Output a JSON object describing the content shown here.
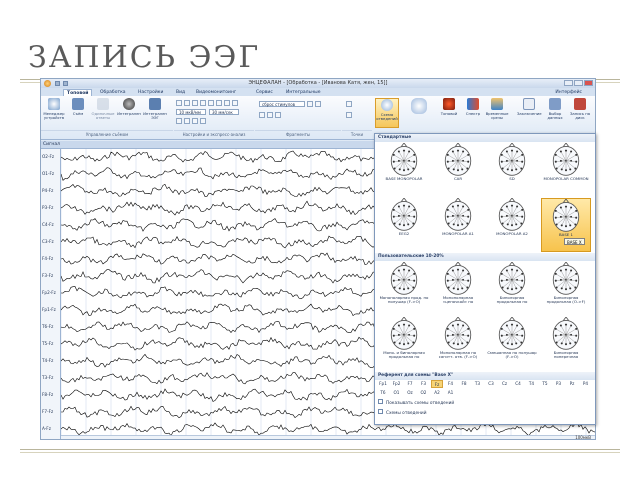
{
  "slide": {
    "title": "ЗАПИСЬ ЭЭГ"
  },
  "window": {
    "title": "ЭНЦЕФАЛАН - [Обработка - [Иванова Катя, жен, 15]]",
    "help_menu": "Интерфейс"
  },
  "tabs": [
    "Топовой",
    "Обработка",
    "Настройки",
    "Вид",
    "Видеомонитоинг",
    "Сервис",
    "Интегральные"
  ],
  "ribbon": {
    "buttons": [
      {
        "label": "Менеджер устройств",
        "icon": "devices-icon"
      },
      {
        "label": "Съём",
        "icon": "record-icon"
      },
      {
        "label": "Одиночные ответы",
        "icon": "single-responses-icon"
      },
      {
        "label": "Интегрален",
        "icon": "headphones-icon"
      },
      {
        "label": "Интегрален ЭЭГ",
        "icon": "integral-eeg-icon"
      }
    ],
    "group_labels": [
      "Управление съёмом",
      "Настройки и экспресс-анализ",
      "Фрагменты",
      "Точки"
    ],
    "sensitivity": "10 мкВ/мм",
    "speed": "30 мм/сек",
    "stimulus": "сброс стимулов",
    "right_buttons": [
      {
        "label": "Схема отведений",
        "icon": "montage-scheme-icon"
      },
      {
        "label": "Топовой",
        "icon": "topo-icon"
      },
      {
        "label": "Спектр",
        "icon": "spectrum-icon"
      },
      {
        "label": "Временные срезы",
        "icon": "time-slices-icon"
      },
      {
        "label": "Заключение",
        "icon": "conclusion-icon"
      },
      {
        "label": "Выбор данных",
        "icon": "data-select-icon"
      },
      {
        "label": "Запись на диск",
        "icon": "save-disk-icon"
      }
    ]
  },
  "signal_header": "Сигнал",
  "channels": [
    "O2-Fz",
    "O1-Fz",
    "P4-Fz",
    "P3-Fz",
    "C4-Fz",
    "C3-Fz",
    "F4-Fz",
    "F3-Fz",
    "Fp2-Fz",
    "Fp1-Fz",
    "T6-Fz",
    "T5-Fz",
    "T4-Fz",
    "T3-Fz",
    "F8-Fz",
    "F7-Fz",
    "A-Fz"
  ],
  "scale_label": "100мкВ",
  "montage_popup": {
    "standard_header": "Стандартные",
    "standard": [
      "BASE MONOPOLAR",
      "CAR",
      "SD",
      "MONOPOLAR COMMON",
      "EEG2",
      "MONOPOLAR A1",
      "MONOPOLAR A2",
      "BASE 1"
    ],
    "user_header": "Пользовательские 10-20%",
    "user": [
      "Монополярная прод. по полушар (F->O)",
      "Монополярная «цепочкой» по",
      "Биполярная продольная по",
      "Биполярная продольная (O->F)",
      "Моно- и биполярная продольная по",
      "Монополярная по сагитт. отв. (F->O)",
      "Смешанная по полушар (F->O)",
      "Биполярная поперечная"
    ],
    "ref_header": "Референт для схемы \"Base X\"",
    "refs_row1": [
      "Fp1",
      "Fp2",
      "F7",
      "F3",
      "Fz",
      "F4",
      "F8",
      "T3",
      "C3",
      "Cz",
      "C4",
      "T4",
      "T5",
      "P3",
      "Pz",
      "P4"
    ],
    "refs_row2": [
      "T6",
      "O1",
      "Oz",
      "O2",
      "A2",
      "A1"
    ],
    "selected_ref": "Fz",
    "option_show": "Показывать схемы отведений",
    "option_schemes": "Схемы отведений",
    "tooltip": "BASE X",
    "selected_montage": "BASE 1"
  },
  "colors": {
    "accent": "#2f6fb5",
    "signal": "#000000",
    "highlight": "#f7c34d"
  }
}
